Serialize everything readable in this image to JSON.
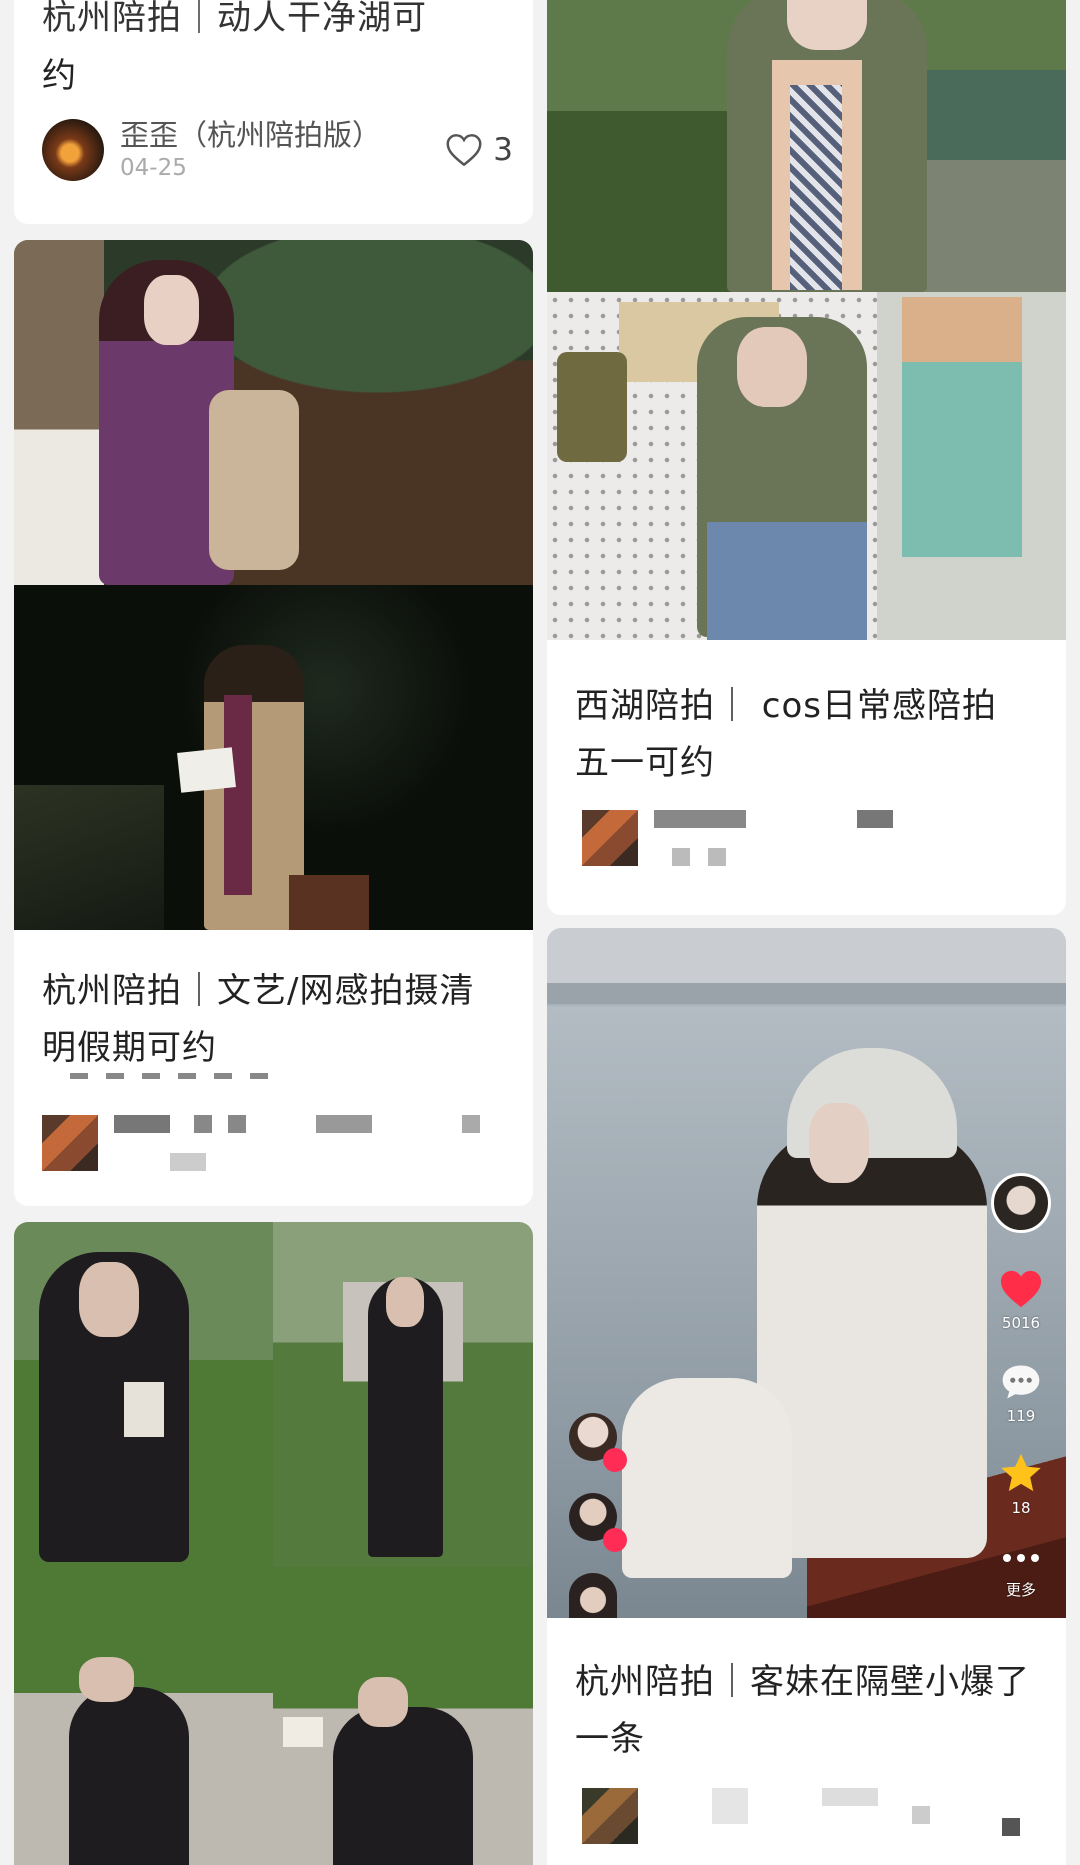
{
  "cards": {
    "top_left": {
      "title_fragment": "杭州陪拍｜动人干净湖可",
      "title_tail": "约",
      "author": "歪歪（杭州陪拍版）",
      "date": "04-25",
      "likes": "3"
    },
    "mid_left": {
      "title": "杭州陪拍｜文艺/网感拍摄清明假期可约"
    },
    "top_right": {
      "title": "西湖陪拍｜ cos日常感陪拍五一可约"
    },
    "bottom_right": {
      "title": "杭州陪拍｜客妹在隔壁小爆了一条",
      "video_overlay": {
        "likes": "5016",
        "comments": "119",
        "favorites": "18",
        "more_label": "更多"
      }
    }
  },
  "icons": {
    "like": "heart-outline-icon",
    "video_like": "heart-filled-icon",
    "video_comment": "comment-bubble-icon",
    "video_favorite": "star-icon",
    "video_more": "more-dots-icon"
  },
  "colors": {
    "background": "#f2f2f2",
    "card": "#ffffff",
    "title": "#222222",
    "like_red": "#ff2d47",
    "star_gold": "#ffc21a"
  }
}
